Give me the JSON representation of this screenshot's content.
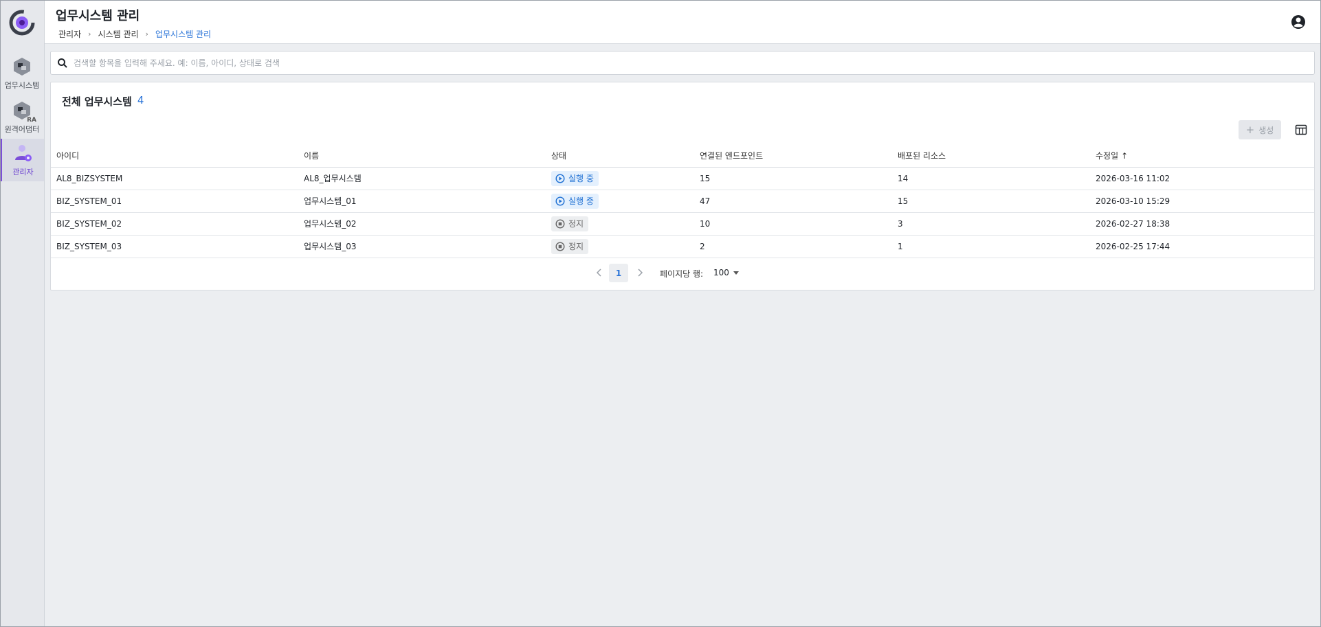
{
  "sidebar": {
    "items": [
      {
        "label": "업무시스템",
        "icon": "business-system-icon"
      },
      {
        "label": "원격어댑터",
        "icon": "remote-adapter-icon",
        "tag": "RA"
      },
      {
        "label": "관리자",
        "icon": "admin-icon",
        "active": true
      }
    ]
  },
  "header": {
    "title": "업무시스템 관리",
    "breadcrumb": [
      "관리자",
      "시스템 관리",
      "업무시스템 관리"
    ]
  },
  "search": {
    "placeholder": "검색할 항목을 입력해 주세요. 예: 이름, 아이디, 상태로 검색"
  },
  "card": {
    "title": "전체 업무시스템",
    "count": "4",
    "create_label": "생성"
  },
  "table": {
    "columns": [
      "아이디",
      "이름",
      "상태",
      "연결된 엔드포인트",
      "배포된 리소스",
      "수정일"
    ],
    "sorted_column": "수정일",
    "rows": [
      {
        "id": "AL8_BIZSYSTEM",
        "name": "AL8_업무시스템",
        "status": "실행 중",
        "status_type": "running",
        "endpoints": "15",
        "resources": "14",
        "modified": "2026-03-16 11:02"
      },
      {
        "id": "BIZ_SYSTEM_01",
        "name": "업무시스템_01",
        "status": "실행 중",
        "status_type": "running",
        "endpoints": "47",
        "resources": "15",
        "modified": "2026-03-10 15:29"
      },
      {
        "id": "BIZ_SYSTEM_02",
        "name": "업무시스템_02",
        "status": "정지",
        "status_type": "stopped",
        "endpoints": "10",
        "resources": "3",
        "modified": "2026-02-27 18:38"
      },
      {
        "id": "BIZ_SYSTEM_03",
        "name": "업무시스템_03",
        "status": "정지",
        "status_type": "stopped",
        "endpoints": "2",
        "resources": "1",
        "modified": "2026-02-25 17:44"
      }
    ]
  },
  "pagination": {
    "current_page": "1",
    "rows_per_page_label": "페이지당 행:",
    "rows_per_page": "100"
  },
  "colors": {
    "accent": "#2a74d8",
    "brand_purple": "#7b4ed8",
    "running_bg": "#e4f0fd",
    "stopped_bg": "#eceef0"
  }
}
